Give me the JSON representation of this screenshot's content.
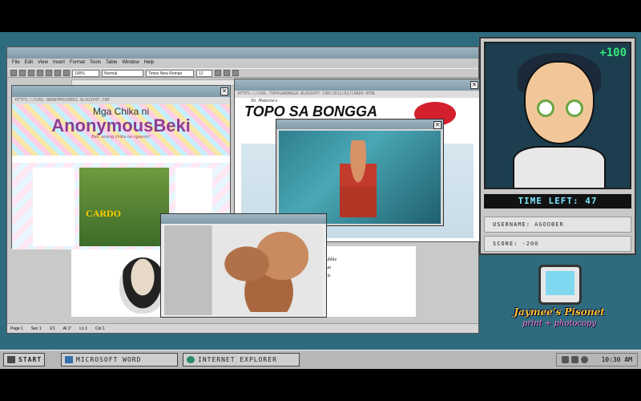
{
  "word": {
    "menus": [
      "File",
      "Edit",
      "View",
      "Insert",
      "Format",
      "Tools",
      "Table",
      "Window",
      "Help"
    ],
    "zoom": "100%",
    "style": "Normal",
    "font": "Times New Roman",
    "font_size": "12",
    "doc_lines": [
      "dwin Hubble",
      "1925, that",
      "romeda is",
      "ay it is"
    ],
    "status": [
      "Page 1",
      "Sec 1",
      "1/1",
      "At 1\"",
      "Ln 1",
      "Col 1"
    ]
  },
  "ie1": {
    "url": "HTTPS://COOL-ANONYMOUSBEKI.BLOGSPOT.COM",
    "blog_title_1": "Mga Chika ni",
    "blog_title_2": "AnonymousBeki",
    "blog_tagline": "Bes, anong chika na ngayon?",
    "cardo_label": "CARDO"
  },
  "ie2": {
    "url": "HTTPS://COOL-TOPOSABONGGA.BLOGSPOT.COM/2012/02/CARDO.HTML",
    "subtitle": "Sh. Malonia's",
    "title": "TOPO SA BONGGA"
  },
  "game": {
    "bonus": "+100",
    "time_label": "TIME LEFT:",
    "time_value": "47",
    "username_label": "USERNAME:",
    "username": "AGOOBER",
    "score_label": "SCORE:",
    "score": "-200"
  },
  "logo": {
    "line1": "Jaymee's Pisonet",
    "line2": "print + photocopy"
  },
  "taskbar": {
    "start": "START",
    "word": "MICROSOFT WORD",
    "ie": "INTERNET EXPLORER",
    "clock": "10:30 AM"
  }
}
